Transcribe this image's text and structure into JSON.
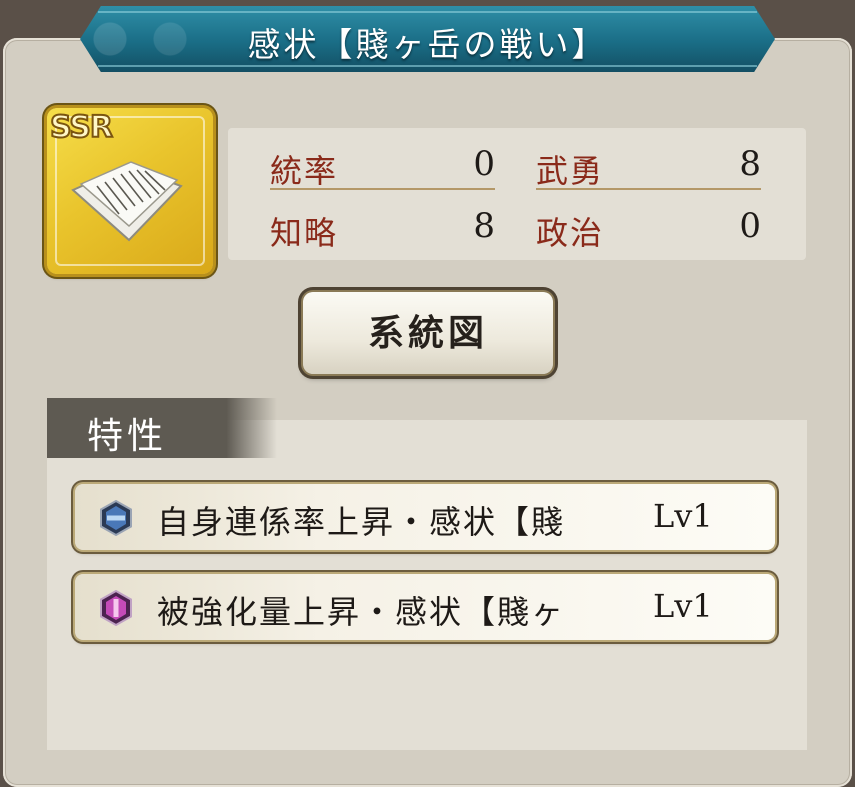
{
  "title": "感状【賤ヶ岳の戦い】",
  "card": {
    "rarity": "SSR",
    "icon": "letter-scroll-icon"
  },
  "stats": {
    "leadership_label": "統率",
    "leadership_value": "0",
    "valor_label": "武勇",
    "valor_value": "8",
    "intellect_label": "知略",
    "intellect_value": "8",
    "politics_label": "政治",
    "politics_value": "0"
  },
  "system_button_label": "系統図",
  "traits": {
    "header": "特性",
    "items": [
      {
        "name": "自身連係率上昇・感状【賤",
        "level": "Lv1",
        "icon": "blue-hexagon-icon"
      },
      {
        "name": "被強化量上昇・感状【賤ヶ",
        "level": "Lv1",
        "icon": "magenta-hexagon-icon"
      }
    ]
  },
  "colors": {
    "title_banner": "#1a6d86",
    "stat_label": "#8a2a1a",
    "panel_bg": "#d3cec2",
    "card_gold": "#e9c42c"
  }
}
